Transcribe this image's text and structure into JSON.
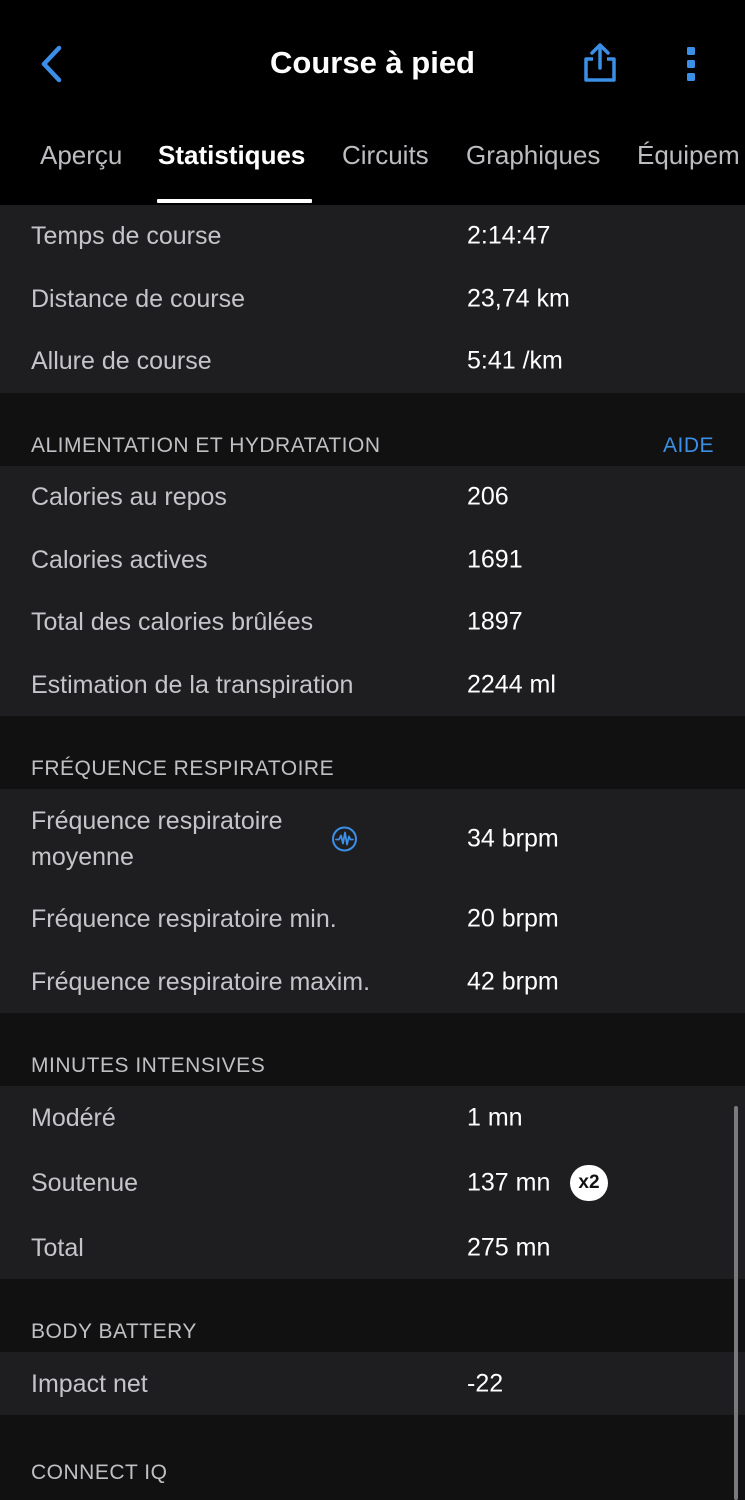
{
  "header": {
    "title": "Course à pied",
    "back_icon": "chevron-left-icon",
    "share_icon": "share-icon",
    "more_icon": "more-vertical-icon",
    "accent_color": "#3b8fe6"
  },
  "tabs": [
    {
      "label": "Aperçu",
      "active": false
    },
    {
      "label": "Statistiques",
      "active": true
    },
    {
      "label": "Circuits",
      "active": false
    },
    {
      "label": "Graphiques",
      "active": false
    },
    {
      "label": "Équipem",
      "active": false
    }
  ],
  "running": {
    "rows": [
      {
        "label": "Temps de course",
        "value": "2:14:47"
      },
      {
        "label": "Distance de course",
        "value": "23,74 km"
      },
      {
        "label": "Allure de course",
        "value": "5:41 /km"
      }
    ]
  },
  "nutrition": {
    "title": "ALIMENTATION ET HYDRATATION",
    "action": "AIDE",
    "rows": [
      {
        "label": "Calories au repos",
        "value": "206"
      },
      {
        "label": "Calories actives",
        "value": "1691"
      },
      {
        "label": "Total des calories brûlées",
        "value": "1897"
      },
      {
        "label": "Estimation de la transpiration",
        "value": "2244 ml"
      }
    ]
  },
  "respiration": {
    "title": "FRÉQUENCE RESPIRATOIRE",
    "rows": [
      {
        "label": "Fréquence respiratoire moyenne",
        "value": "34 brpm",
        "icon": "waveform-icon"
      },
      {
        "label": "Fréquence respiratoire min.",
        "value": "20 brpm"
      },
      {
        "label": "Fréquence respiratoire maxim.",
        "value": "42 brpm"
      }
    ]
  },
  "intensity": {
    "title": "MINUTES INTENSIVES",
    "rows": [
      {
        "label": "Modéré",
        "value": "1 mn"
      },
      {
        "label": "Soutenue",
        "value": "137 mn",
        "badge": "x2"
      },
      {
        "label": "Total",
        "value": "275 mn"
      }
    ]
  },
  "body_battery": {
    "title": "BODY BATTERY",
    "rows": [
      {
        "label": "Impact net",
        "value": "-22"
      }
    ]
  },
  "connect_iq": {
    "title": "CONNECT IQ"
  }
}
